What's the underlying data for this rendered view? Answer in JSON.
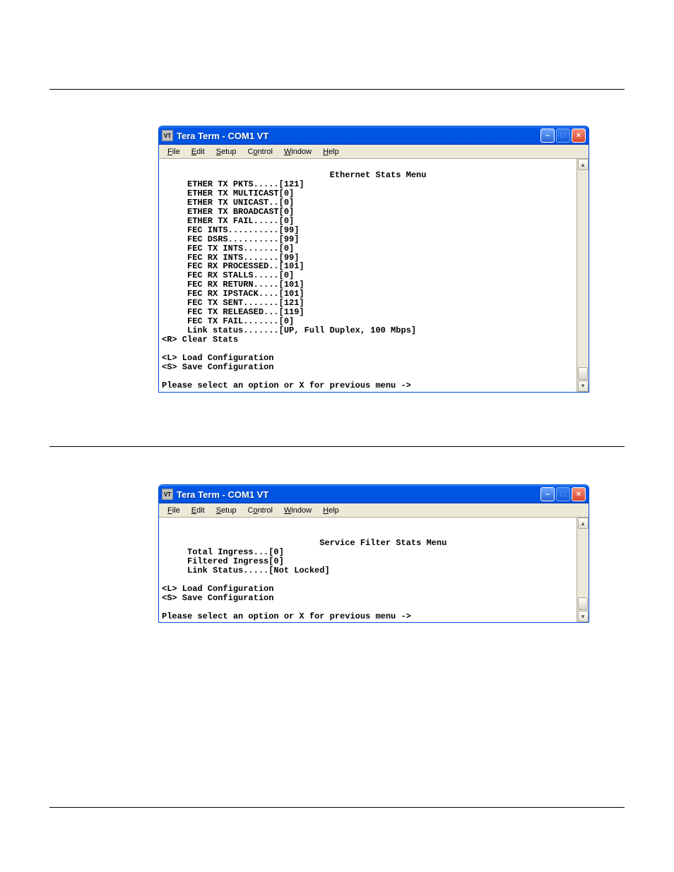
{
  "window1": {
    "title": "Tera Term - COM1 VT",
    "menus": {
      "file": "File",
      "edit": "Edit",
      "setup": "Setup",
      "control": "Control",
      "window": "Window",
      "help": "Help"
    },
    "terminal": {
      "heading": "Ethernet Stats Menu",
      "lines": [
        "     ETHER TX PKTS.....[121]",
        "     ETHER TX MULTICAST[0]",
        "     ETHER TX UNICAST..[0]",
        "     ETHER TX BROADCAST[0]",
        "     ETHER TX FAIL.....[0]",
        "     FEC INTS..........[99]",
        "     FEC DSRS..........[99]",
        "     FEC TX INTS.......[0]",
        "     FEC RX INTS.......[99]",
        "     FEC RX PROCESSED..[101]",
        "     FEC RX STALLS.....[0]",
        "     FEC RX RETURN.....[101]",
        "     FEC RX IPSTACK....[101]",
        "     FEC TX SENT.......[121]",
        "     FEC TX RELEASED...[119]",
        "     FEC TX FAIL.......[0]",
        "     Link status.......[UP, Full Duplex, 100 Mbps]",
        "<R> Clear Stats",
        "",
        "<L> Load Configuration",
        "<S> Save Configuration",
        "",
        "Please select an option or X for previous menu ->"
      ]
    }
  },
  "window2": {
    "title": "Tera Term - COM1 VT",
    "menus": {
      "file": "File",
      "edit": "Edit",
      "setup": "Setup",
      "control": "Control",
      "window": "Window",
      "help": "Help"
    },
    "terminal": {
      "heading": "Service Filter Stats Menu",
      "lines": [
        "     Total Ingress...[0]",
        "     Filtered Ingress[0]",
        "     Link Status.....[Not Locked]",
        "",
        "<L> Load Configuration",
        "<S> Save Configuration",
        "",
        "Please select an option or X for previous menu ->"
      ]
    }
  }
}
